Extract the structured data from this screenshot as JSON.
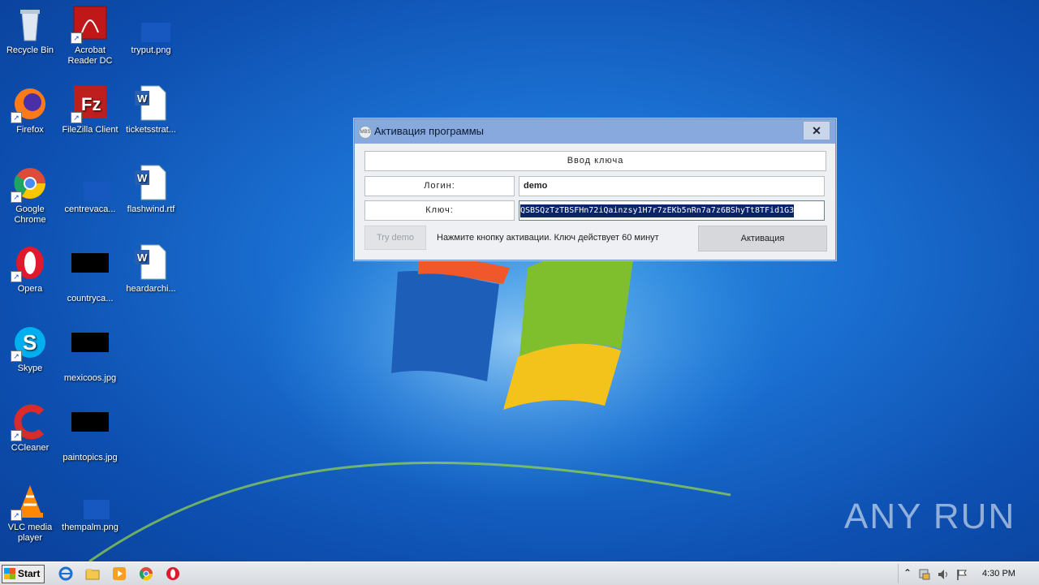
{
  "desktop": {
    "icons": [
      {
        "label": "Recycle Bin"
      },
      {
        "label": "Acrobat Reader DC"
      },
      {
        "label": "tryput.png"
      },
      {
        "label": "Firefox"
      },
      {
        "label": "FileZilla Client"
      },
      {
        "label": "ticketsstrat..."
      },
      {
        "label": "Google Chrome"
      },
      {
        "label": "centrevaca..."
      },
      {
        "label": "flashwind.rtf"
      },
      {
        "label": "Opera"
      },
      {
        "label": "countryca..."
      },
      {
        "label": "heardarchi..."
      },
      {
        "label": "Skype"
      },
      {
        "label": "mexicoos.jpg"
      },
      {
        "label": "CCleaner"
      },
      {
        "label": "paintopics.jpg"
      },
      {
        "label": "VLC media player"
      },
      {
        "label": "thempalm.png"
      }
    ]
  },
  "dialog": {
    "title": "Активация программы",
    "title_icon_text": "MBS",
    "header_label": "Ввод ключа",
    "login_label": "Логин:",
    "login_value": "demo",
    "key_label": "Ключ:",
    "key_value": "QSBSQzTzTBSFHn72iQainzsy1H7r7zEKb5nRn7a7z6BShyTt8TFid1G3",
    "try_demo_label": "Try demo",
    "hint_text": "Нажмите кнопку активации. Ключ действует 60 минут",
    "activate_label": "Активация",
    "close_symbol": "✕"
  },
  "taskbar": {
    "start_label": "Start",
    "clock": "4:30 PM"
  },
  "watermark": "ANY RUN",
  "colors": {
    "titlebar": "#87a9dd",
    "desktop": "#1a6fd0"
  }
}
